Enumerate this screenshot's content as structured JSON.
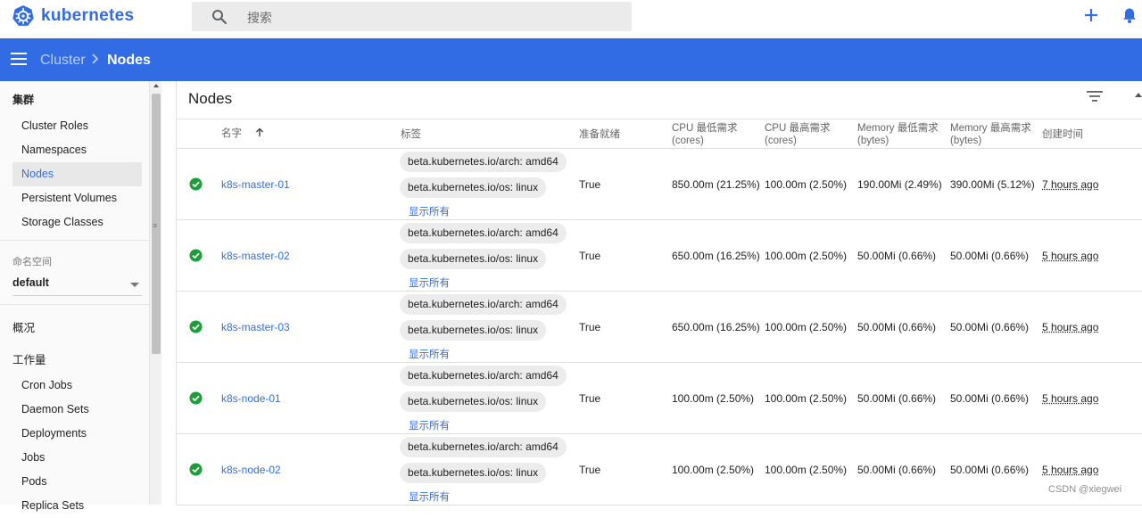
{
  "app": {
    "name": "kubernetes",
    "brand_color": "#326ce5"
  },
  "search": {
    "placeholder": "搜索"
  },
  "header_actions": {
    "create_icon": "plus-icon",
    "notifications_icon": "bell-icon"
  },
  "breadcrumb": {
    "parent": "Cluster",
    "current": "Nodes"
  },
  "sidebar": {
    "cluster_section": "集群",
    "cluster_items": [
      {
        "label": "Cluster Roles",
        "active": false
      },
      {
        "label": "Namespaces",
        "active": false
      },
      {
        "label": "Nodes",
        "active": true
      },
      {
        "label": "Persistent Volumes",
        "active": false
      },
      {
        "label": "Storage Classes",
        "active": false
      }
    ],
    "namespace_label": "命名空间",
    "namespace_value": "default",
    "overview_section": "概况",
    "workloads_section": "工作量",
    "workload_items": [
      {
        "label": "Cron Jobs"
      },
      {
        "label": "Daemon Sets"
      },
      {
        "label": "Deployments"
      },
      {
        "label": "Jobs"
      },
      {
        "label": "Pods"
      },
      {
        "label": "Replica Sets"
      }
    ]
  },
  "page": {
    "title": "Nodes",
    "filter_icon": "filter-list-icon"
  },
  "table": {
    "columns": {
      "name": "名字",
      "labels": "标签",
      "ready": "准备就绪",
      "cpu_requests": [
        "CPU 最低需求",
        "(cores)"
      ],
      "cpu_limits": [
        "CPU 最高需求",
        "(cores)"
      ],
      "mem_requests": [
        "Memory 最低需求",
        "(bytes)"
      ],
      "mem_limits": [
        "Memory 最高需求",
        "(bytes)"
      ],
      "created": "创建时间"
    },
    "sort_indicator": "arrow-upward-icon",
    "show_all_label": "显示所有",
    "rows": [
      {
        "status": "ready",
        "name": "k8s-master-01",
        "labels": [
          "beta.kubernetes.io/arch: amd64",
          "beta.kubernetes.io/os: linux"
        ],
        "ready": "True",
        "cpu_req": "850.00m (21.25%)",
        "cpu_lim": "100.00m (2.50%)",
        "mem_req": "190.00Mi (2.49%)",
        "mem_lim": "390.00Mi (5.12%)",
        "created": "7 hours ago"
      },
      {
        "status": "ready",
        "name": "k8s-master-02",
        "labels": [
          "beta.kubernetes.io/arch: amd64",
          "beta.kubernetes.io/os: linux"
        ],
        "ready": "True",
        "cpu_req": "650.00m (16.25%)",
        "cpu_lim": "100.00m (2.50%)",
        "mem_req": "50.00Mi (0.66%)",
        "mem_lim": "50.00Mi (0.66%)",
        "created": "5 hours ago"
      },
      {
        "status": "ready",
        "name": "k8s-master-03",
        "labels": [
          "beta.kubernetes.io/arch: amd64",
          "beta.kubernetes.io/os: linux"
        ],
        "ready": "True",
        "cpu_req": "650.00m (16.25%)",
        "cpu_lim": "100.00m (2.50%)",
        "mem_req": "50.00Mi (0.66%)",
        "mem_lim": "50.00Mi (0.66%)",
        "created": "5 hours ago"
      },
      {
        "status": "ready",
        "name": "k8s-node-01",
        "labels": [
          "beta.kubernetes.io/arch: amd64",
          "beta.kubernetes.io/os: linux"
        ],
        "ready": "True",
        "cpu_req": "100.00m (2.50%)",
        "cpu_lim": "100.00m (2.50%)",
        "mem_req": "50.00Mi (0.66%)",
        "mem_lim": "50.00Mi (0.66%)",
        "created": "5 hours ago"
      },
      {
        "status": "ready",
        "name": "k8s-node-02",
        "labels": [
          "beta.kubernetes.io/arch: amd64",
          "beta.kubernetes.io/os: linux"
        ],
        "ready": "True",
        "cpu_req": "100.00m (2.50%)",
        "cpu_lim": "100.00m (2.50%)",
        "mem_req": "50.00Mi (0.66%)",
        "mem_lim": "50.00Mi (0.66%)",
        "created": "5 hours ago"
      }
    ]
  },
  "watermark": "CSDN @xiegwei",
  "colors": {
    "toolbar": "#326ce5",
    "ready_green": "#1e9e3a",
    "link": "#326ce5"
  }
}
